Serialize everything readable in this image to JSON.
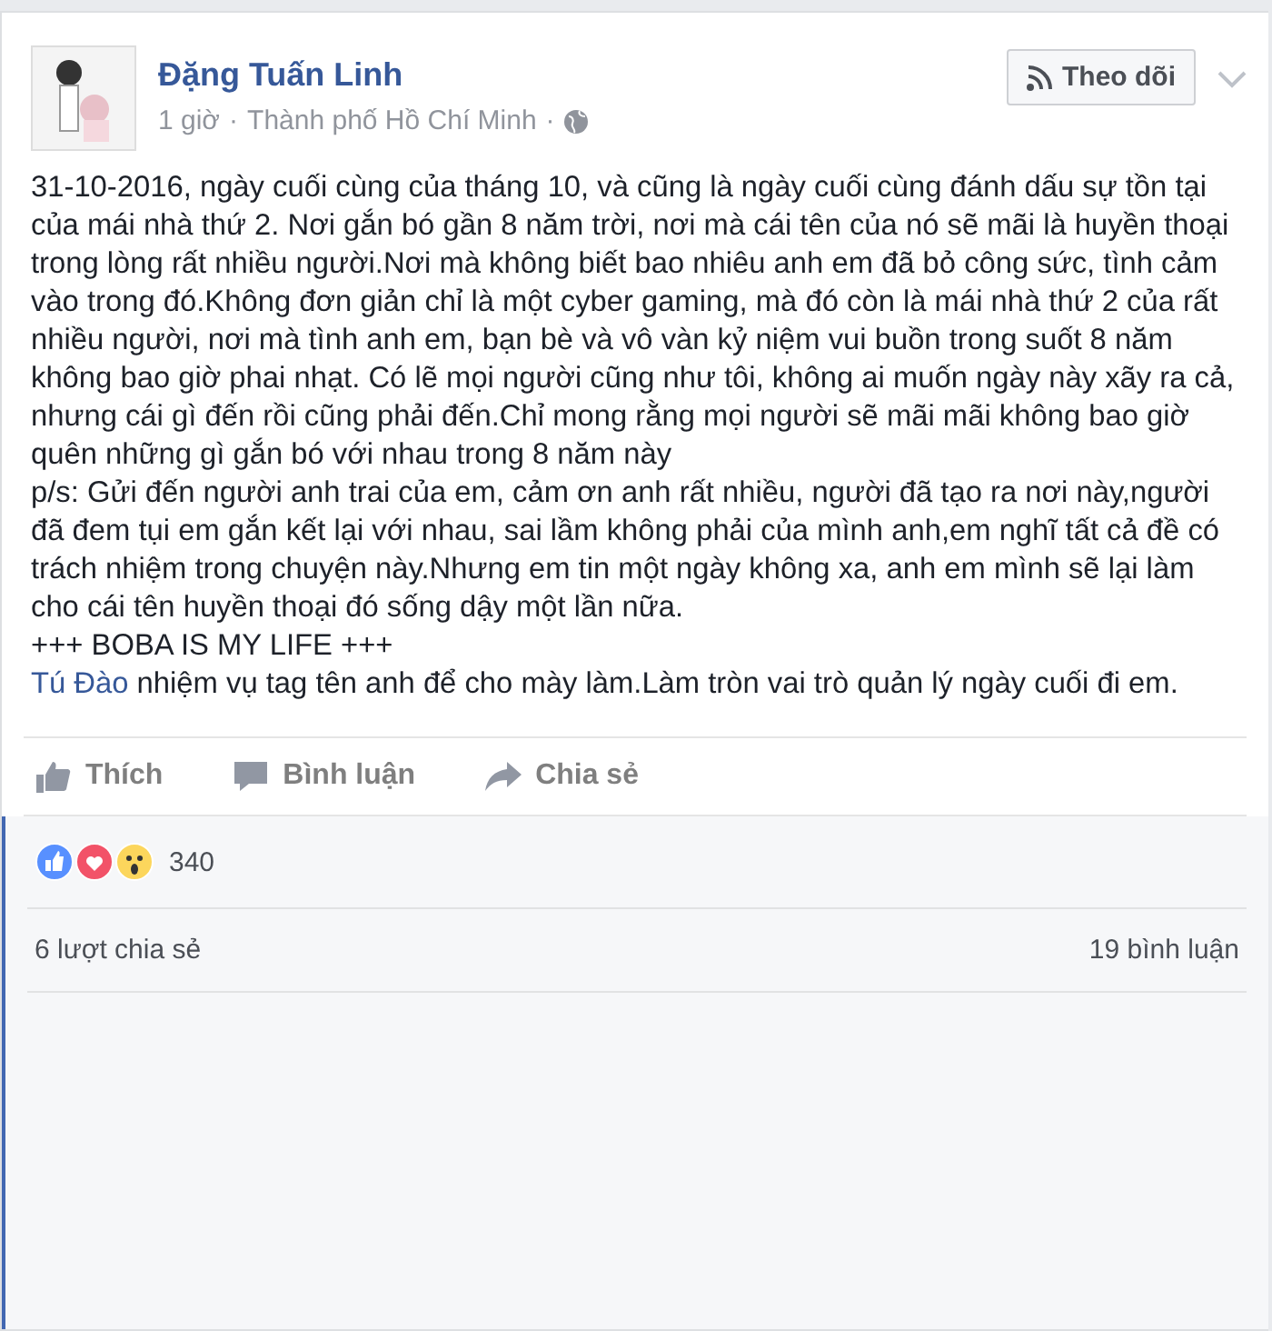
{
  "post": {
    "author": "Đặng Tuấn Linh",
    "time": "1 giờ",
    "location": "Thành phố Hồ Chí Minh",
    "separator": "·",
    "follow_button": "Theo dõi",
    "paragraphs": [
      "31-10-2016, ngày cuối cùng của tháng 10, và cũng là ngày cuối cùng đánh dấu sự tồn tại của mái nhà thứ 2. Nơi gắn bó gần 8 năm trời, nơi mà cái tên của nó sẽ mãi là huyền thoại trong lòng rất nhiều người.Nơi mà không biết bao nhiêu anh em đã bỏ công sức, tình cảm vào trong đó.Không đơn giản chỉ là một cyber gaming, mà đó còn là mái nhà thứ 2 của rất nhiều người, nơi mà tình anh em, bạn bè và vô vàn kỷ niệm vui buồn trong suốt 8 năm không bao giờ phai nhạt. Có lẽ mọi người cũng như tôi, không ai muốn ngày này xãy ra cả, nhưng cái gì đến rồi cũng phải đến.Chỉ mong rằng mọi người sẽ mãi mãi không bao giờ quên những gì gắn bó với nhau trong 8 năm này",
      "p/s: Gửi đến người anh trai của em, cảm ơn anh rất nhiều, người đã tạo ra nơi này,người đã đem tụi em gắn kết lại với nhau, sai lầm không phải của mình anh,em nghĩ tất cả đề có trách nhiệm trong chuyện này.Nhưng em tin một ngày không xa, anh em mình sẽ lại làm cho cái tên huyền thoại đó sống dậy một lần nữa.",
      "+++ BOBA IS MY LIFE +++"
    ],
    "tag": {
      "name": "Tú Đào",
      "text": " nhiệm vụ tag tên anh để cho mày làm.Làm tròn vai trò quản lý ngày cuối đi em."
    },
    "actions": [
      "Thích",
      "Bình luận",
      "Chia sẻ"
    ],
    "reaction_count": "340",
    "shares": "6 lượt chia sẻ",
    "comments": "19 bình luận"
  }
}
